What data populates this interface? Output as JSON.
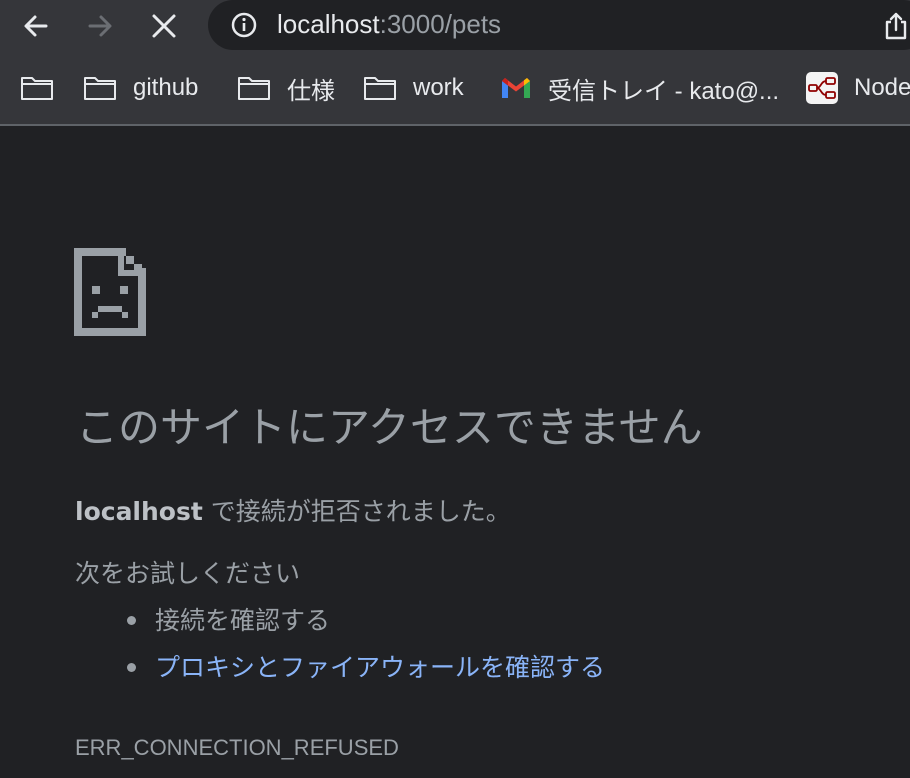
{
  "browser": {
    "url_host": "localhost",
    "url_path": ":3000/pets"
  },
  "bookmarks": [
    {
      "icon": "folder-icon",
      "label": ""
    },
    {
      "icon": "folder-icon",
      "label": "github"
    },
    {
      "icon": "folder-icon",
      "label": "仕様"
    },
    {
      "icon": "folder-icon",
      "label": "work"
    },
    {
      "icon": "gmail-icon",
      "label": "受信トレイ - kato@..."
    },
    {
      "icon": "node-red-icon",
      "label": "Node"
    }
  ],
  "error_page": {
    "headline": "このサイトにアクセスできません",
    "host": "localhost",
    "description": " で接続が拒否されました。",
    "try_label": "次をお試しください",
    "suggestions": [
      "接続を確認する",
      "プロキシとファイアウォールを確認する"
    ],
    "error_code": "ERR_CONNECTION_REFUSED"
  },
  "colors": {
    "background": "#202124",
    "toolbar": "#35363a",
    "link": "#8ab4f8",
    "text_secondary": "#9aa0a6"
  }
}
